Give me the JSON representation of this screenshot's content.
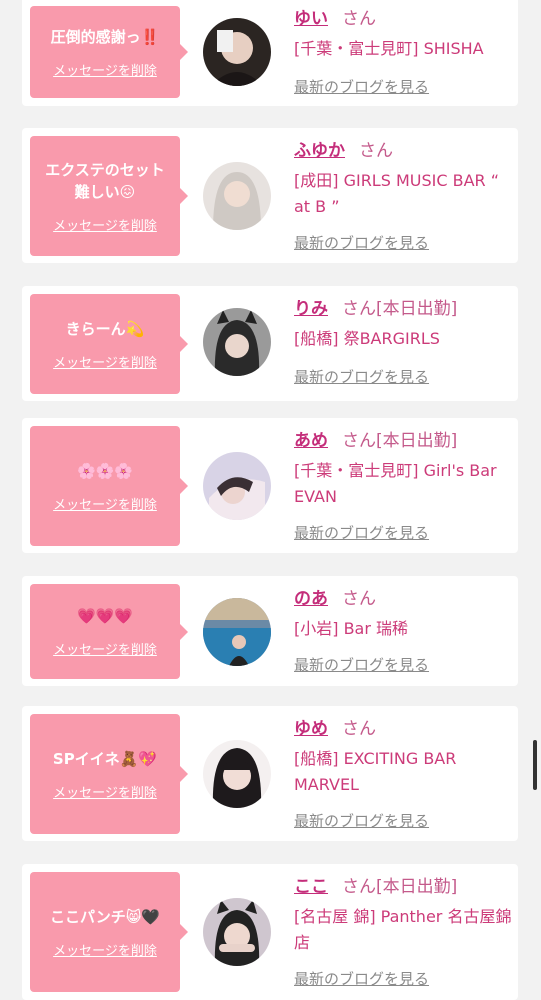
{
  "items": [
    {
      "message": "圧倒的感謝っ‼️",
      "delete_label": "メッセージを削除",
      "name": "ゆい",
      "san": "さん",
      "status": "",
      "shop": "[千葉・富士見町] SHISHA",
      "blog_link": "最新のブログを見る"
    },
    {
      "message": "エクステのセット難しい😖",
      "delete_label": "メッセージを削除",
      "name": "ふゆか",
      "san": "さん",
      "status": "",
      "shop": "[成田] GIRLS MUSIC BAR “ at B ”",
      "blog_link": "最新のブログを見る"
    },
    {
      "message": "きらーん💫",
      "delete_label": "メッセージを削除",
      "name": "りみ",
      "san": "さん",
      "status": "[本日出勤]",
      "shop": "[船橋] 祭BARGIRLS",
      "blog_link": "最新のブログを見る"
    },
    {
      "message": "🌸🌸🌸",
      "delete_label": "メッセージを削除",
      "name": "あめ",
      "san": "さん",
      "status": "[本日出勤]",
      "shop": "[千葉・富士見町] Girl's Bar EVAN",
      "blog_link": "最新のブログを見る"
    },
    {
      "message": "💗💗💗",
      "delete_label": "メッセージを削除",
      "name": "のあ",
      "san": "さん",
      "status": "",
      "shop": "[小岩] Bar 瑞稀",
      "blog_link": "最新のブログを見る"
    },
    {
      "message": "SPイイネ🧸💖",
      "delete_label": "メッセージを削除",
      "name": "ゆめ",
      "san": "さん",
      "status": "",
      "shop": "[船橋] EXCITING BAR MARVEL",
      "blog_link": "最新のブログを見る"
    },
    {
      "message": "ここパンチ😸🖤",
      "delete_label": "メッセージを削除",
      "name": "ここ",
      "san": "さん",
      "status": "[本日出勤]",
      "shop": "[名古屋 錦] Panther 名古屋錦店",
      "blog_link": "最新のブログを見る"
    }
  ],
  "colors": {
    "bubble": "#f99aac",
    "name": "#c42d7a",
    "shop": "#cc3b79",
    "link": "#8a8a8a"
  }
}
